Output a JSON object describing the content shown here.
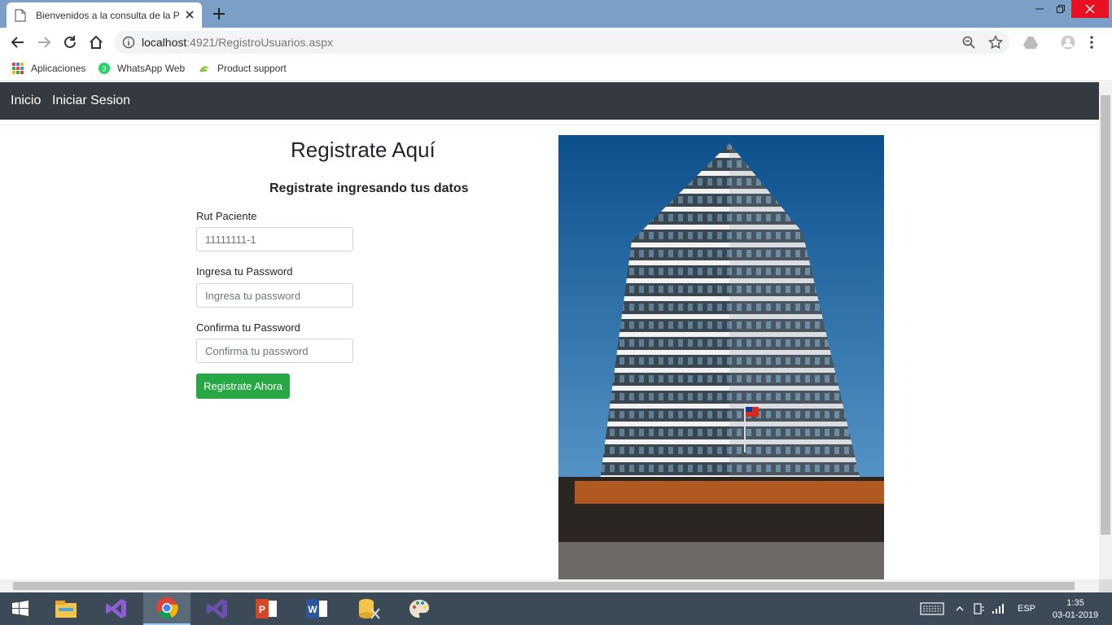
{
  "browser": {
    "tab_title": "Bienvenidos a la consulta de la P",
    "url_host": "localhost",
    "url_path": ":4921/RegistroUsuarios.aspx"
  },
  "bookmarks": [
    {
      "label": "Aplicaciones",
      "icon": "apps-grid-icon"
    },
    {
      "label": "WhatsApp Web",
      "icon": "whatsapp-icon"
    },
    {
      "label": "Product support",
      "icon": "product-support-icon"
    }
  ],
  "navbar": {
    "home_label": "Inicio",
    "login_label": "Iniciar Sesion"
  },
  "form": {
    "title": "Registrate Aquí",
    "subtitle": "Registrate ingresando tus datos",
    "rut_label": "Rut Paciente",
    "rut_placeholder": "11111111-1",
    "password_label": "Ingresa tu Password",
    "password_placeholder": "Ingresa tu password",
    "confirm_label": "Confirma tu Password",
    "confirm_placeholder": "Confirma tu password",
    "submit_label": "Registrate Ahora"
  },
  "taskbar": {
    "language": "ESP",
    "time": "1:35",
    "date": "03-01-2019"
  },
  "colors": {
    "navbar_bg": "#343a40",
    "submit_bg": "#28a745",
    "chrome_frame": "#7aa0c8"
  }
}
